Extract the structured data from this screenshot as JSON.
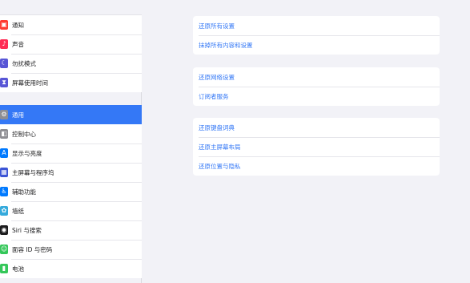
{
  "sidebar": {
    "group1": [
      {
        "label": "通知",
        "icon": "notification-icon",
        "color": "#ff3b30",
        "glyph": "▣"
      },
      {
        "label": "声音",
        "icon": "sound-icon",
        "color": "#ff2d55",
        "glyph": "♪"
      },
      {
        "label": "勿扰模式",
        "icon": "moon-icon",
        "color": "#5856d6",
        "glyph": "☾"
      },
      {
        "label": "屏幕使用时间",
        "icon": "hourglass-icon",
        "color": "#5856d6",
        "glyph": "⧗"
      }
    ],
    "group2": [
      {
        "label": "通用",
        "icon": "gear-icon",
        "color": "#8e8e93",
        "glyph": "⚙",
        "active": true
      },
      {
        "label": "控制中心",
        "icon": "control-center-icon",
        "color": "#8e8e93",
        "glyph": "◧"
      },
      {
        "label": "显示与亮度",
        "icon": "display-icon",
        "color": "#007aff",
        "glyph": "A"
      },
      {
        "label": "主屏幕与程序坞",
        "icon": "home-screen-icon",
        "color": "#3c55d6",
        "glyph": "▦"
      },
      {
        "label": "辅助功能",
        "icon": "accessibility-icon",
        "color": "#007aff",
        "glyph": "♿"
      },
      {
        "label": "墙纸",
        "icon": "wallpaper-icon",
        "color": "#35aadc",
        "glyph": "✿"
      },
      {
        "label": "Siri 与搜索",
        "icon": "siri-icon",
        "color": "#1c1c1e",
        "glyph": "◉"
      },
      {
        "label": "面容 ID 与密码",
        "icon": "face-id-icon",
        "color": "#34c759",
        "glyph": "☺"
      },
      {
        "label": "电池",
        "icon": "battery-icon",
        "color": "#34c759",
        "glyph": "▮"
      }
    ]
  },
  "content": {
    "card1": [
      "还原所有设置",
      "抹掉所有内容和设置"
    ],
    "card2": [
      "还原网络设置",
      "订阅者服务"
    ],
    "card3": [
      "还原键盘词典",
      "还原主屏幕布局",
      "还原位置与隐私"
    ]
  },
  "accent": "#3478f6"
}
